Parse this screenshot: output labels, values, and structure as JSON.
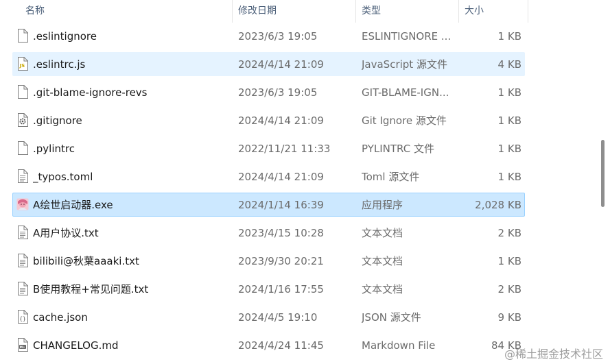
{
  "header": {
    "name": "名称",
    "date": "修改日期",
    "type": "类型",
    "size": "大小",
    "sort_indicator": "^"
  },
  "files": [
    {
      "name": ".eslintignore",
      "date": "2023/6/3 19:05",
      "type": "ESLINTIGNORE ...",
      "size": "1 KB",
      "icon": "blank-file-icon"
    },
    {
      "name": ".eslintrc.js",
      "date": "2024/4/14 21:09",
      "type": "JavaScript 源文件",
      "size": "4 KB",
      "icon": "javascript-file-icon"
    },
    {
      "name": ".git-blame-ignore-revs",
      "date": "2023/6/3 19:05",
      "type": "GIT-BLAME-IGN...",
      "size": "1 KB",
      "icon": "blank-file-icon"
    },
    {
      "name": ".gitignore",
      "date": "2024/4/14 21:09",
      "type": "Git Ignore 源文件",
      "size": "1 KB",
      "icon": "settings-file-icon"
    },
    {
      "name": ".pylintrc",
      "date": "2022/11/21 11:33",
      "type": "PYLINTRC 文件",
      "size": "1 KB",
      "icon": "blank-file-icon"
    },
    {
      "name": "_typos.toml",
      "date": "2024/4/14 21:09",
      "type": "Toml 源文件",
      "size": "1 KB",
      "icon": "text-file-icon"
    },
    {
      "name": "A绘世启动器.exe",
      "date": "2024/1/14 16:39",
      "type": "应用程序",
      "size": "2,028 KB",
      "icon": "app-avatar-icon"
    },
    {
      "name": "A用户协议.txt",
      "date": "2023/4/15 10:28",
      "type": "文本文档",
      "size": "2 KB",
      "icon": "text-file-icon"
    },
    {
      "name": "bilibili@秋葉aaaki.txt",
      "date": "2023/9/30 20:21",
      "type": "文本文档",
      "size": "1 KB",
      "icon": "text-file-icon"
    },
    {
      "name": "B使用教程+常见问题.txt",
      "date": "2024/1/16 17:55",
      "type": "文本文档",
      "size": "2 KB",
      "icon": "text-file-icon"
    },
    {
      "name": "cache.json",
      "date": "2024/4/5 19:10",
      "type": "JSON 源文件",
      "size": "9 KB",
      "icon": "json-file-icon"
    },
    {
      "name": "CHANGELOG.md",
      "date": "2024/4/24 11:45",
      "type": "Markdown File",
      "size": "84 KB",
      "icon": "markdown-file-icon"
    }
  ],
  "watermark": "@稀土掘金技术社区",
  "colors": {
    "hover": "#e5f3ff",
    "selected": "#cce8ff",
    "selected_border": "#99d1ff",
    "header_text": "#4c607a"
  }
}
